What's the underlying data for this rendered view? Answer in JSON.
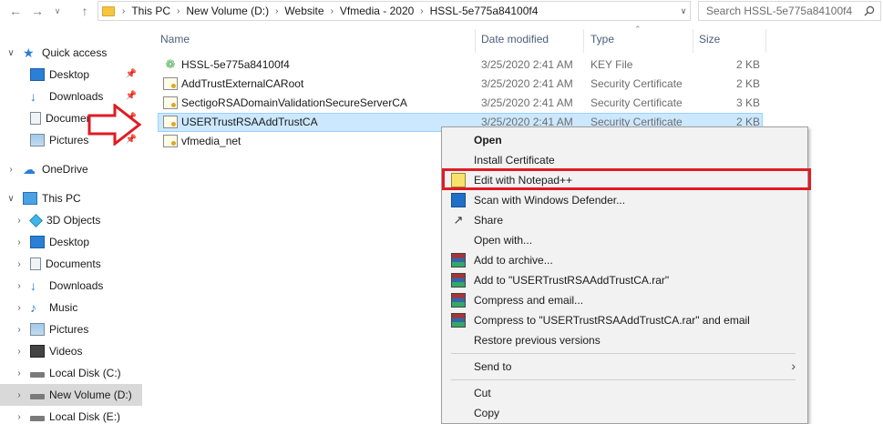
{
  "address_bar": {
    "crumbs": [
      "This PC",
      "New Volume (D:)",
      "Website",
      "Vfmedia - 2020",
      "HSSL-5e775a84100f4"
    ]
  },
  "search": {
    "placeholder": "Search HSSL-5e775a84100f4"
  },
  "sidebar": {
    "items": [
      {
        "label": "Quick access",
        "icon": "star-icon"
      },
      {
        "label": "Desktop",
        "icon": "desktop-icon"
      },
      {
        "label": "Downloads",
        "icon": "downloads-icon"
      },
      {
        "label": "Documents",
        "icon": "documents-icon"
      },
      {
        "label": "Pictures",
        "icon": "pictures-icon"
      },
      {
        "label": "OneDrive",
        "icon": "onedrive-icon"
      },
      {
        "label": "This PC",
        "icon": "pc-icon"
      },
      {
        "label": "3D Objects",
        "icon": "3d-objects-icon"
      },
      {
        "label": "Desktop",
        "icon": "desktop-icon"
      },
      {
        "label": "Documents",
        "icon": "documents-icon"
      },
      {
        "label": "Downloads",
        "icon": "downloads-icon"
      },
      {
        "label": "Music",
        "icon": "music-icon"
      },
      {
        "label": "Pictures",
        "icon": "pictures-icon"
      },
      {
        "label": "Videos",
        "icon": "videos-icon"
      },
      {
        "label": "Local Disk (C:)",
        "icon": "drive-icon"
      },
      {
        "label": "New Volume (D:)",
        "icon": "drive-icon"
      },
      {
        "label": "Local Disk (E:)",
        "icon": "drive-icon"
      }
    ]
  },
  "columns": {
    "name": "Name",
    "date": "Date modified",
    "type": "Type",
    "size": "Size"
  },
  "files": [
    {
      "name": "HSSL-5e775a84100f4",
      "date": "3/25/2020 2:41 AM",
      "type": "KEY File",
      "size": "2 KB",
      "icon": "key-file-icon"
    },
    {
      "name": "AddTrustExternalCARoot",
      "date": "3/25/2020 2:41 AM",
      "type": "Security Certificate",
      "size": "2 KB",
      "icon": "certificate-icon"
    },
    {
      "name": "SectigoRSADomainValidationSecureServerCA",
      "date": "3/25/2020 2:41 AM",
      "type": "Security Certificate",
      "size": "3 KB",
      "icon": "certificate-icon"
    },
    {
      "name": "USERTrustRSAAddTrustCA",
      "date": "3/25/2020 2:41 AM",
      "type": "Security Certificate",
      "size": "2 KB",
      "icon": "certificate-icon"
    },
    {
      "name": "vfmedia_net",
      "date": "",
      "type": "",
      "size": "",
      "icon": "certificate-icon"
    }
  ],
  "context_menu": {
    "items": [
      {
        "label": "Open"
      },
      {
        "label": "Install Certificate"
      },
      {
        "label": "Edit with Notepad++"
      },
      {
        "label": "Scan with Windows Defender..."
      },
      {
        "label": "Share"
      },
      {
        "label": "Open with..."
      },
      {
        "label": "Add to archive..."
      },
      {
        "label": "Add to \"USERTrustRSAAddTrustCA.rar\""
      },
      {
        "label": "Compress and email..."
      },
      {
        "label": "Compress to \"USERTrustRSAAddTrustCA.rar\" and email"
      },
      {
        "label": "Restore previous versions"
      },
      {
        "label": "Send to"
      },
      {
        "label": "Cut"
      },
      {
        "label": "Copy"
      }
    ]
  },
  "colors": {
    "selection": "#cce8ff",
    "annotation_red": "#e01b24"
  }
}
